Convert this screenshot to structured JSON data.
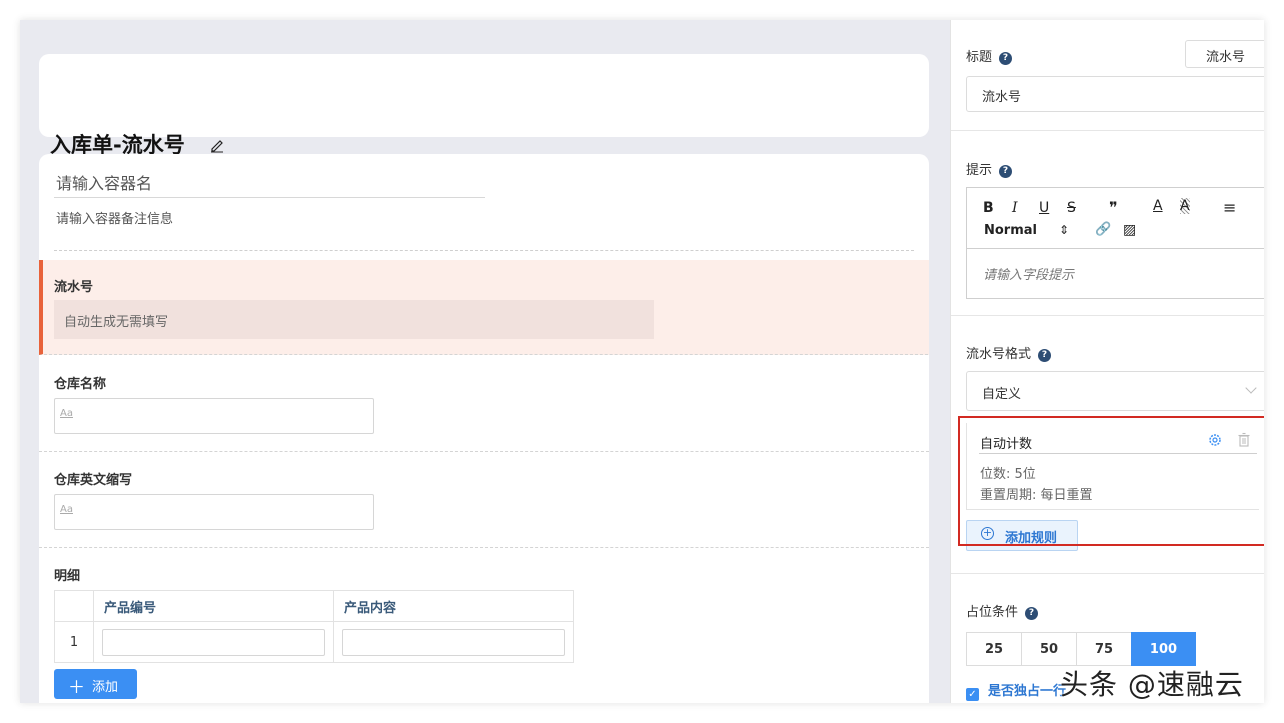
{
  "form": {
    "title": "入库单-流水号",
    "container_name_placeholder": "请输入容器名",
    "container_note_placeholder": "请输入容器备注信息"
  },
  "fields": {
    "serial": {
      "label": "流水号",
      "placeholder": "自动生成无需填写"
    },
    "warehouse_name": {
      "label": "仓库名称",
      "hint": "Aa"
    },
    "warehouse_abbr": {
      "label": "仓库英文缩写",
      "hint": "Aa"
    }
  },
  "detail": {
    "label": "明细",
    "columns": [
      "产品编号",
      "产品内容"
    ],
    "rows": [
      {
        "index": "1"
      }
    ],
    "add_label": "添加"
  },
  "panel": {
    "title_label": "标题",
    "title_pill": "流水号",
    "title_value": "流水号",
    "hint_label": "提示",
    "editor": {
      "bold": "B",
      "italic": "I",
      "underline": "U",
      "strike": "S",
      "quote": "❞",
      "font_color": "A",
      "bg_color": "A",
      "align": "≡",
      "size": "Normal",
      "size_arrow": "⇕",
      "link": "🔗",
      "image": "▨",
      "placeholder": "请输入字段提示"
    },
    "format_label": "流水号格式",
    "format_value": "自定义",
    "rule": {
      "title": "自动计数",
      "digits": "位数: 5位",
      "reset": "重置周期:  每日重置"
    },
    "add_rule_label": "添加规则",
    "width_label": "占位条件",
    "width_options": [
      "25",
      "50",
      "75",
      "100"
    ],
    "exclusive_label": "是否独占一行"
  },
  "watermark": "头条 @速融云",
  "colors": {
    "accent": "#3b8ff3",
    "highlight_border": "#e8623a",
    "annotation_red": "#d22a22"
  }
}
